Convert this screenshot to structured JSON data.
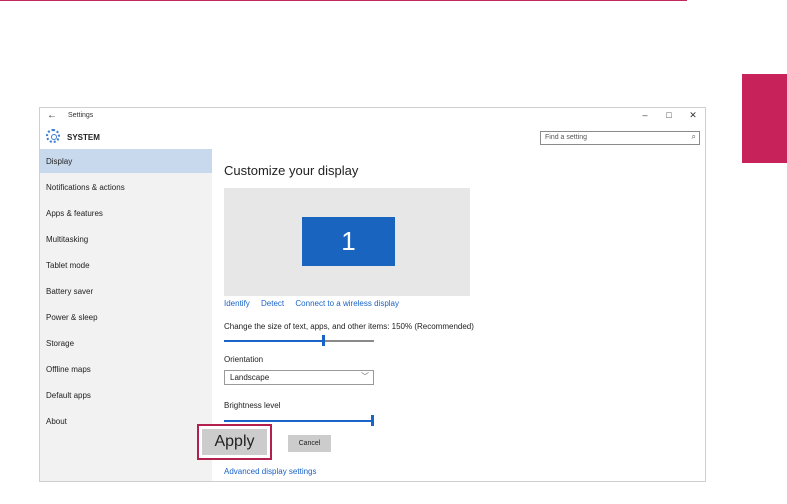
{
  "window": {
    "title": "Settings",
    "back_glyph": "←",
    "controls": {
      "minimize": "–",
      "maximize": "□",
      "close": "✕"
    }
  },
  "header": {
    "section_title": "SYSTEM",
    "section_icon": "gear-icon",
    "search_placeholder": "Find a setting",
    "search_icon_glyph": "⌕"
  },
  "sidebar": {
    "items": [
      {
        "label": "Display",
        "active": true
      },
      {
        "label": "Notifications & actions"
      },
      {
        "label": "Apps & features"
      },
      {
        "label": "Multitasking"
      },
      {
        "label": "Tablet mode"
      },
      {
        "label": "Battery saver"
      },
      {
        "label": "Power & sleep"
      },
      {
        "label": "Storage"
      },
      {
        "label": "Offline maps"
      },
      {
        "label": "Default apps"
      },
      {
        "label": "About"
      }
    ]
  },
  "main": {
    "heading": "Customize your display",
    "monitor_number": "1",
    "links": [
      "Identify",
      "Detect",
      "Connect to a wireless display"
    ],
    "scale_label": "Change the size of text, apps, and other items: 150% (Recommended)",
    "scale_slider_fraction": 0.67,
    "orientation_label": "Orientation",
    "orientation_value": "Landscape",
    "brightness_label": "Brightness level",
    "brightness_fraction": 1.0,
    "apply_label": "Apply",
    "cancel_label": "Cancel",
    "advanced_link": "Advanced display settings"
  },
  "colors": {
    "accent": "#1a63c7",
    "highlight_frame": "#b3204d",
    "side_tab": "#c72259",
    "monitor_tile": "#1864bf"
  }
}
